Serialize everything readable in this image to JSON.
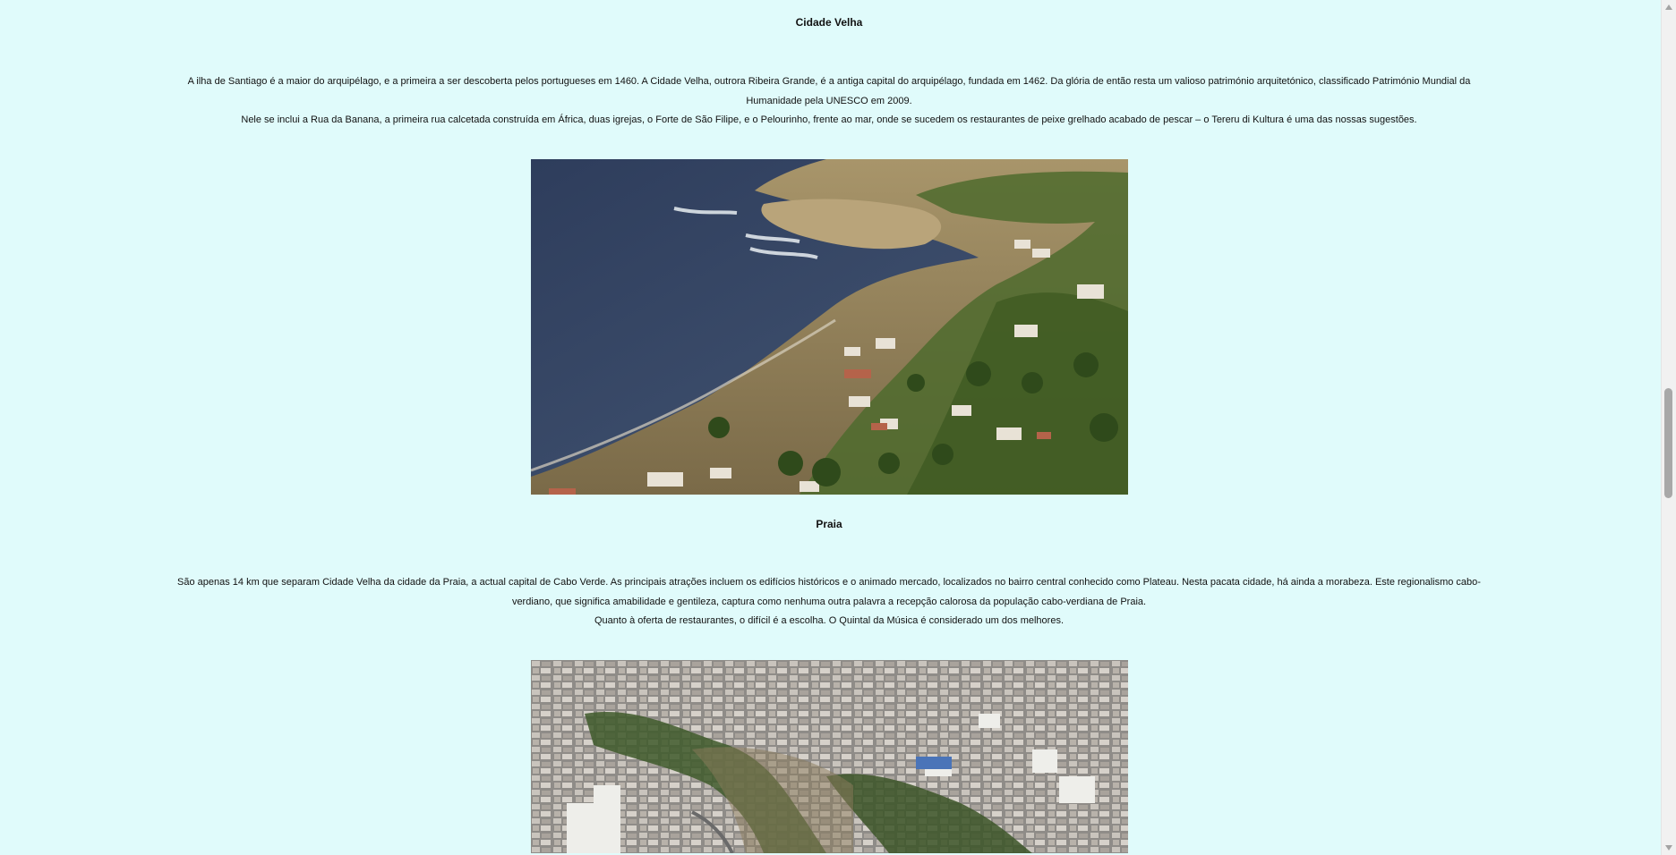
{
  "sections": [
    {
      "title": "Cidade Velha",
      "paragraph_1": "A ilha de Santiago é a maior do arquipélago, e a primeira a ser descoberta pelos portugueses em 1460. A Cidade Velha, outrora Ribeira Grande, é a antiga capital do arquipélago, fundada em 1462. Da glória de então resta um valioso património arquitetónico, classificado Património Mundial da Humanidade pela UNESCO em 2009.",
      "paragraph_2": "Nele se inclui a Rua da Banana, a primeira rua calcetada construída em África, duas igrejas, o Forte de São Filipe, e o Pelourinho, frente ao mar, onde se sucedem os restaurantes de peixe grelhado acabado de pescar – o Tereru di Kultura é uma das nossas sugestões.",
      "image_name": "aerial-coastal-village-photo"
    },
    {
      "title": "Praia",
      "paragraph_1": "São apenas 14 km que separam Cidade Velha da cidade da Praia, a actual capital de Cabo Verde. As principais atrações incluem os edifícios históricos e o animado mercado, localizados no bairro central conhecido como Plateau. Nesta pacata cidade, há ainda a morabeza. Este regionalismo cabo-verdiano, que significa amabilidade e gentileza, captura como nenhuma outra palavra a recepção calorosa da população cabo-verdiana de Praia.",
      "paragraph_2": "Quanto à oferta de restaurantes, o difícil é a escolha. O Quintal da Música é considerado um dos melhores.",
      "image_name": "aerial-city-photo"
    }
  ],
  "colors": {
    "page_background": "#e0fbfb",
    "scrollbar_track": "#f1f1f1",
    "scrollbar_thumb": "#a8a8a8"
  },
  "icons": {
    "scroll_up": "triangle-up-icon",
    "scroll_down": "triangle-down-icon"
  }
}
